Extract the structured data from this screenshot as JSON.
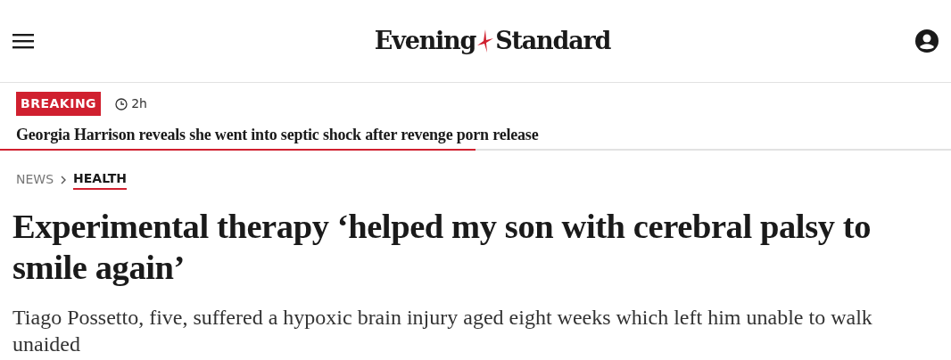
{
  "header": {
    "logo": {
      "word_1": "Evening",
      "word_2": "Standard"
    }
  },
  "breaking": {
    "badge": "BREAKING",
    "time": "2h",
    "headline": "Georgia Harrison reveals she went into septic shock after revenge porn release",
    "level": 0.5
  },
  "breadcrumb": [
    {
      "label": "NEWS",
      "selected": false
    },
    {
      "label": "HEALTH",
      "selected": true
    }
  ],
  "article": {
    "headline": "Experimental therapy ‘helped my son with cerebral palsy to smile again’",
    "standfirst": "Tiago Possetto, five, suffered a hypoxic brain injury aged eight weeks which left him unable to walk unaided"
  }
}
